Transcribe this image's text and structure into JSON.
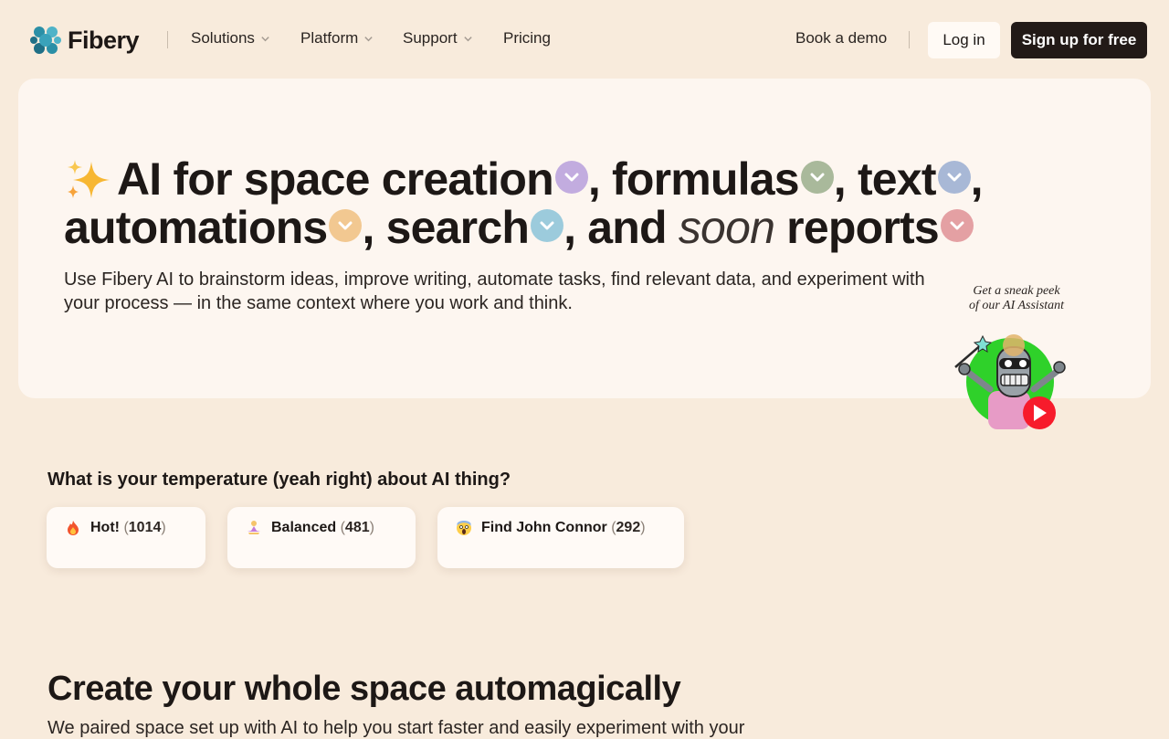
{
  "brand": {
    "name": "Fibery",
    "logo_icon": "fibery-logo-icon"
  },
  "nav": {
    "items": [
      {
        "label": "Solutions",
        "has_dropdown": true
      },
      {
        "label": "Platform",
        "has_dropdown": true
      },
      {
        "label": "Support",
        "has_dropdown": true
      },
      {
        "label": "Pricing",
        "has_dropdown": false
      }
    ],
    "book_demo": "Book a demo",
    "login": "Log in",
    "signup": "Sign up for free"
  },
  "hero": {
    "headline": {
      "p1": "AI for space creation",
      "p2": ", formulas",
      "p3": ", text",
      "p4": ",",
      "p5": "automations",
      "p6": ", search",
      "p7": ", and ",
      "p8": "soon",
      "p9": " reports"
    },
    "pill_colors": {
      "space_creation": "#c2acdf",
      "formulas": "#a9b99b",
      "text": "#a8b8d6",
      "automations": "#f2c891",
      "search": "#9ccbdc",
      "reports": "#e4a0a3"
    },
    "subtext": "Use Fibery AI to brainstorm ideas, improve writing, automate tasks, find relevant data, and experiment with your process — in the same context where you work and think.",
    "peek_line1": "Get a sneak peek",
    "peek_line2": "of our AI Assistant"
  },
  "poll": {
    "question": "What is your temperature (yeah right) about AI thing?",
    "options": [
      {
        "icon": "fire-icon",
        "label": "Hot!",
        "count": "1014"
      },
      {
        "icon": "meditating-person-icon",
        "label": "Balanced",
        "count": "481"
      },
      {
        "icon": "screaming-face-icon",
        "label": "Find John Connor",
        "count": "292"
      }
    ]
  },
  "section": {
    "title": "Create your whole space automagically",
    "subtitle": "We paired space set up with AI to help you start faster and easily experiment with your"
  }
}
